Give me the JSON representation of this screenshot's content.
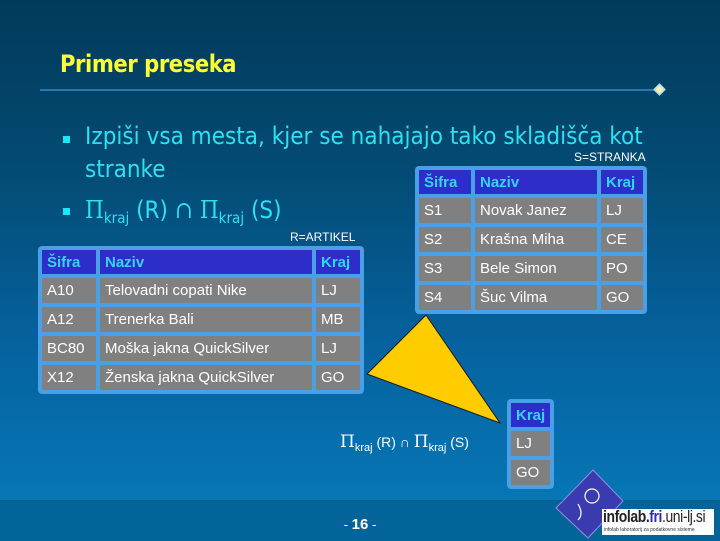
{
  "slide": {
    "title": "Primer preseka",
    "bullets": [
      {
        "line1": "Izpiši vsa mesta, kjer se nahajajo tako skladišča kot",
        "line2": "stranke"
      },
      {
        "pi": "Π",
        "sub": "kraj",
        "rel1": "(R)",
        "op": "∩",
        "rel2": "(S)"
      }
    ],
    "colors": {
      "title": "#ffff33",
      "bullet_text": "#2ee0f0",
      "table_header_bg": "#2d2dcc",
      "table_header_text": "#33d6f2",
      "table_cell_bg": "#808080",
      "table_frame": "#4aa0e6",
      "arrow": "#ffcc00"
    }
  },
  "relation_r": {
    "caption": "R=ARTIKEL",
    "columns": [
      "Šifra",
      "Naziv",
      "Kraj"
    ],
    "rows": [
      [
        "A10",
        "Telovadni copati Nike",
        "LJ"
      ],
      [
        "A12",
        "Trenerka Bali",
        "MB"
      ],
      [
        "BC80",
        "Moška jakna QuickSilver",
        "LJ"
      ],
      [
        "X12",
        "Ženska jakna QuickSilver",
        "GO"
      ]
    ]
  },
  "relation_s": {
    "caption": "S=STRANKA",
    "columns": [
      "Šifra",
      "Naziv",
      "Kraj"
    ],
    "rows": [
      [
        "S1",
        "Novak Janez",
        "LJ"
      ],
      [
        "S2",
        "Krašna Miha",
        "CE"
      ],
      [
        "S3",
        "Bele Simon",
        "PO"
      ],
      [
        "S4",
        "Šuc Vilma",
        "GO"
      ]
    ]
  },
  "result": {
    "expression": {
      "pi": "Π",
      "sub": "kraj",
      "rel1": "(R)",
      "op": "∩",
      "rel2": "(S)"
    },
    "columns": [
      "Kraj"
    ],
    "rows": [
      [
        "LJ"
      ],
      [
        "GO"
      ]
    ]
  },
  "footer": {
    "page_prefix": "- ",
    "page_number": "16",
    "page_suffix": " -",
    "logo": {
      "part1": "infolab.",
      "part2": "fri",
      "part3": ".uni-lj.si",
      "tagline": "infolab laboratorij za podatkovne sisteme"
    }
  }
}
